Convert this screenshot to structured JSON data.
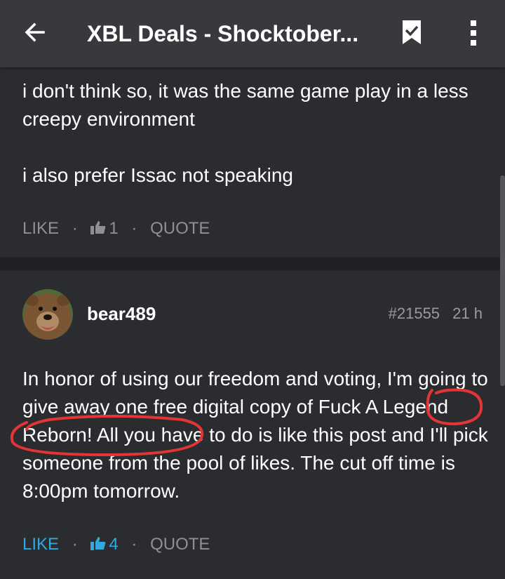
{
  "appbar": {
    "title": "XBL Deals - Shocktober...",
    "back_icon": "arrow-left-icon",
    "bookmark_icon": "bookmark-check-icon",
    "more_icon": "more-vertical-icon"
  },
  "post1": {
    "paragraphs": [
      "i don't think so, it was the same game play in a less creepy environment",
      "i also prefer Issac not speaking"
    ],
    "actions": {
      "like": "LIKE",
      "sep": "·",
      "like_count": "1",
      "quote": "QUOTE"
    }
  },
  "post2": {
    "username": "bear489",
    "post_number": "#21555",
    "time_ago": "21 h",
    "text": "In honor of using our freedom and voting, I'm going to give away one free digital copy of Fuck A Legend Reborn! All you have to do is like this post and I'll pick someone from the pool of likes. The cut off time is 8:00pm tomorrow.",
    "actions": {
      "like": "LIKE",
      "sep": "·",
      "like_count": "4",
      "quote": "QUOTE"
    }
  },
  "colors": {
    "background": "#2b2c30",
    "appbar": "#38393d",
    "divider": "#202124",
    "muted_text": "#8f9094",
    "liked_accent": "#30a9de",
    "annotation_red": "#e33535"
  }
}
